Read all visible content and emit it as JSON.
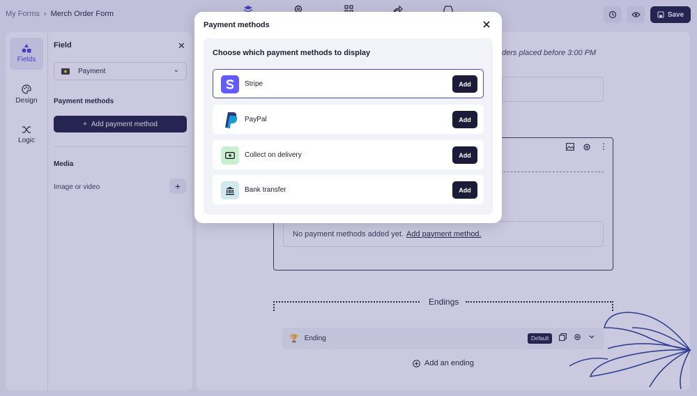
{
  "header": {
    "breadcrumb_root": "My Forms",
    "breadcrumb_separator": "›",
    "breadcrumb_current": "Merch Order Form",
    "save_label": "Save"
  },
  "rail": {
    "items": [
      {
        "label": "Fields",
        "icon": "shapes-icon"
      },
      {
        "label": "Design",
        "icon": "palette-icon"
      },
      {
        "label": "Logic",
        "icon": "shuffle-icon"
      }
    ]
  },
  "field_panel": {
    "title": "Field",
    "type_value": "Payment",
    "payment_methods_label": "Payment methods",
    "add_payment_method_label": "Add payment method",
    "media_label": "Media",
    "image_or_video_label": "Image or video"
  },
  "canvas": {
    "cutoff_text": "ders placed before 3:00 PM",
    "no_methods_text": "No payment methods added yet.",
    "no_methods_link": "Add payment method.",
    "endings_title": "Endings",
    "ending_label": "Ending",
    "default_badge": "Default",
    "add_ending_label": "Add an ending"
  },
  "modal": {
    "title": "Payment methods",
    "heading": "Choose which payment methods to display",
    "methods": [
      {
        "name": "Stripe",
        "add_label": "Add",
        "icon": "stripe-logo",
        "color": "#635bff"
      },
      {
        "name": "PayPal",
        "add_label": "Add",
        "icon": "paypal-logo",
        "color": "#253b80"
      },
      {
        "name": "Collect on delivery",
        "add_label": "Add",
        "icon": "cash-icon",
        "color": "#c9efcf"
      },
      {
        "name": "Bank transfer",
        "add_label": "Add",
        "icon": "bank-icon",
        "color": "#cfe9ee"
      }
    ]
  },
  "colors": {
    "primary_dark": "#1c1b3a",
    "accent": "#5046c8",
    "overlay": "#403c8c"
  }
}
